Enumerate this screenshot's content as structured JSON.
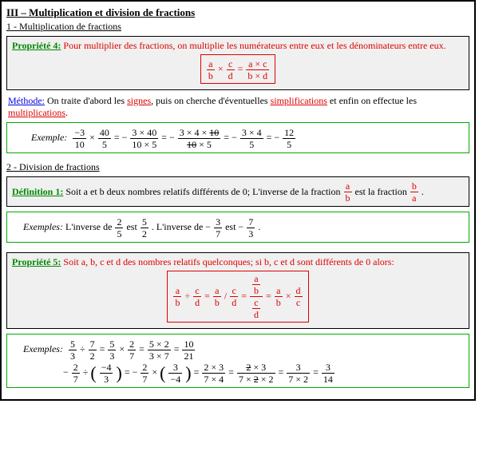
{
  "heading": "III – Multiplication et division de fractions",
  "sec1": {
    "title": "1 - Multiplication de fractions",
    "prop4": {
      "label": "Propriété 4:",
      "text": "Pour multiplier des fractions, on multiplie les numérateurs entre eux et les dénominateurs entre eux.",
      "formula": {
        "a": "a",
        "b": "b",
        "c": "c",
        "d": "d",
        "ac": "a × c",
        "bd": "b × d",
        "times": "×",
        "eq": "="
      }
    },
    "method": {
      "label": "Méthode:",
      "t1": "On traite d'abord les ",
      "u1": "signes",
      "t2": ", puis on cherche d'éventuelles ",
      "u2": "simplifications",
      "t3": " et enfin on effectue les ",
      "u3": "multiplications",
      "t4": "."
    },
    "example": {
      "label": "Exemple:",
      "f1n": "−3",
      "f1d": "10",
      "f2n": "40",
      "f2d": "5",
      "s2n": "3 × 40",
      "s2d": "10 × 5",
      "s3na": "3 × 4 × ",
      "s3nb": "10",
      "s3da": "10",
      "s3db": " × 5",
      "s4n": "3 × 4",
      "s4d": "5",
      "s5n": "12",
      "s5d": "5",
      "neg": "−",
      "eq": "= −",
      "times": "×"
    }
  },
  "sec2": {
    "title": "2 - Division de fractions",
    "def1": {
      "label": "Définition 1:",
      "t1": "Soit a et b deux nombres relatifs différents de 0; L'inverse de la fraction ",
      "t2": " est la fraction ",
      "t3": ".",
      "a": "a",
      "b": "b"
    },
    "ex_inv": {
      "label": "Exemples:",
      "t1": "L'inverse de ",
      "f1n": "2",
      "f1d": "5",
      "t2": " est ",
      "f2n": "5",
      "f2d": "2",
      "t3": ". L'inverse de ",
      "neg": "−",
      "f3n": "3",
      "f3d": "7",
      "t4": " est ",
      "f4n": "7",
      "f4d": "3",
      "t5": "."
    },
    "prop5": {
      "label": "Propriété 5:",
      "text": "Soit a, b, c et d des nombres relatifs quelconques; si b, c et d sont différents de 0 alors:",
      "a": "a",
      "b": "b",
      "c": "c",
      "d": "d",
      "div": "÷",
      "eq": "=",
      "slash": "/",
      "times": "×"
    },
    "ex_div": {
      "label": "Exemples:",
      "line1": {
        "f1n": "5",
        "f1d": "3",
        "f2n": "7",
        "f2d": "2",
        "r1n": "5 × 2",
        "r1d": "3 × 7",
        "r2n": "10",
        "r2d": "21",
        "div": "÷",
        "eq": "=",
        "times": "×"
      },
      "line2": {
        "f1n": "2",
        "f1d": "7",
        "f2n": "−4",
        "f2d": "3",
        "f3n": "3",
        "f3d": "−4",
        "s1n": "2 × 3",
        "s1d": "7 × 4",
        "s2na": "2",
        "s2nb": " × 3",
        "s2da": "7 × ",
        "s2db": "2",
        "s2dc": " × 2",
        "s3n": "3",
        "s3d": "7 × 2",
        "s4n": "3",
        "s4d": "14",
        "neg": "−",
        "eq": "=",
        "times": "×",
        "div": "÷"
      }
    }
  }
}
